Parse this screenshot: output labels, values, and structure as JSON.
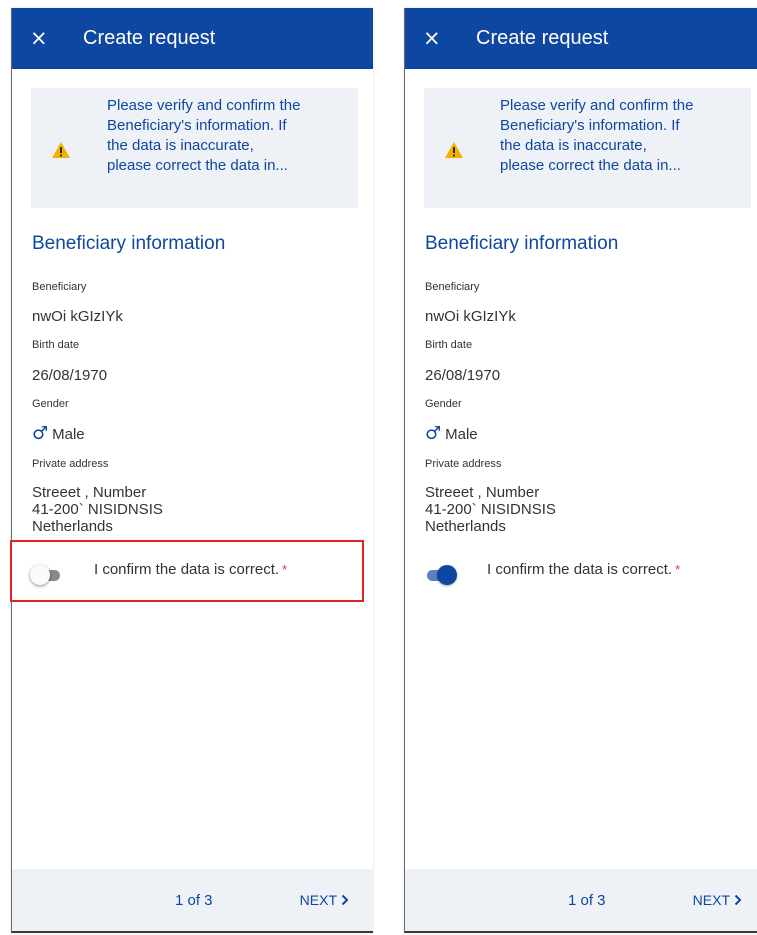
{
  "header": {
    "close_icon": "×",
    "title": "Create request"
  },
  "alert": {
    "icon": "warning-icon",
    "line1": "Please verify and confirm the",
    "line2": "Beneficiary's information. If",
    "line3": "the data is inaccurate,",
    "line4": "please correct the data in...",
    "icon_color": "#f0b400"
  },
  "section": {
    "title": "Beneficiary information"
  },
  "fields": {
    "beneficiary_label": "Beneficiary",
    "beneficiary_value": "nwOi kGIzIYk",
    "birth_label": "Birth date",
    "birth_value": "26/08/1970",
    "gender_label": "Gender",
    "gender_icon": "♂",
    "gender_value": "Male",
    "address_label": "Private address",
    "address_line1": "Streeet , Number",
    "address_line2": "41-200` NISIDNSIS",
    "address_line3": "Netherlands"
  },
  "confirm": {
    "label": "I confirm the data is correct.",
    "required_mark": "*"
  },
  "panels": [
    {
      "state": "off",
      "highlighted": true
    },
    {
      "state": "on",
      "highlighted": false
    }
  ],
  "footer": {
    "pager": "1 of 3",
    "next": "NEXT"
  },
  "colors": {
    "primary": "#0e47a1",
    "alert_bg": "#eef2f7",
    "highlight": "#e02424",
    "required": "#d9334b"
  }
}
